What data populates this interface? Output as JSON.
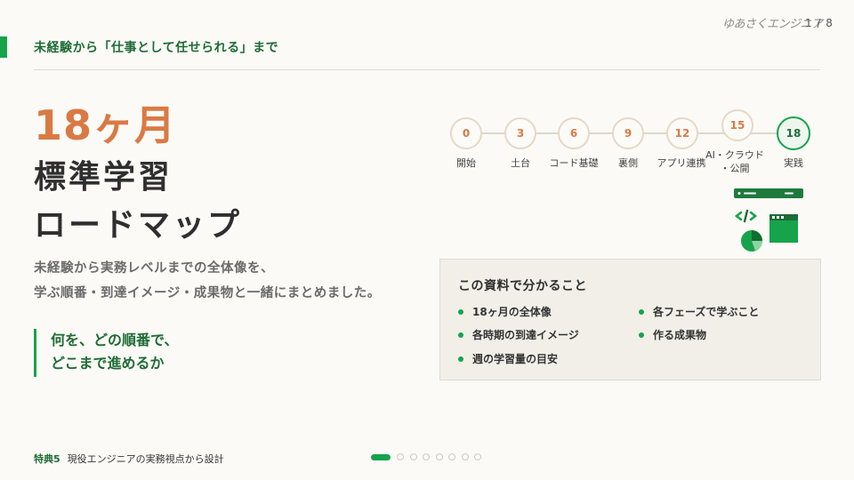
{
  "header": {
    "title": "未経験から「仕事として任せられる」まで",
    "brand": "ゆあさくエンジニア",
    "page_indicator": "1 / 8"
  },
  "hero": {
    "duration": "18ヶ月",
    "title_line1": "標準学習",
    "title_line2": "ロードマップ",
    "subtitle_line1": "未経験から実務レベルまでの全体像を、",
    "subtitle_line2": "学ぶ順番・到達イメージ・成果物と一緒にまとめました。",
    "quote_line1": "何を、どの順番で、",
    "quote_line2": "どこまで進めるか"
  },
  "timeline": {
    "nodes": [
      {
        "month": "0",
        "label": "開始"
      },
      {
        "month": "3",
        "label": "土台"
      },
      {
        "month": "6",
        "label": "コード基礎"
      },
      {
        "month": "9",
        "label": "裏側"
      },
      {
        "month": "12",
        "label": "アプリ連携"
      },
      {
        "month": "15",
        "label_line1": "AI・クラウド",
        "label_line2": "・公開"
      },
      {
        "month": "18",
        "label": "実践"
      }
    ]
  },
  "illustration": {
    "icons": [
      "browser-window-icon",
      "code-icon",
      "pie-chart-icon",
      "dashboard-icon"
    ]
  },
  "info_box": {
    "title": "この資料で分かること",
    "items": [
      "18ヶ月の全体像",
      "各フェーズで学ぶこと",
      "各時期の到達イメージ",
      "作る成果物",
      "週の学習量の目安"
    ]
  },
  "footer": {
    "tag": "特典5",
    "text": "現役エンジニアの実務視点から設計"
  },
  "pager": {
    "total": 8,
    "current": 1
  },
  "colors": {
    "accent_green": "#16a34a",
    "dark_green": "#1e6b35",
    "orange": "#d97a45",
    "background": "#fbfaf6"
  }
}
